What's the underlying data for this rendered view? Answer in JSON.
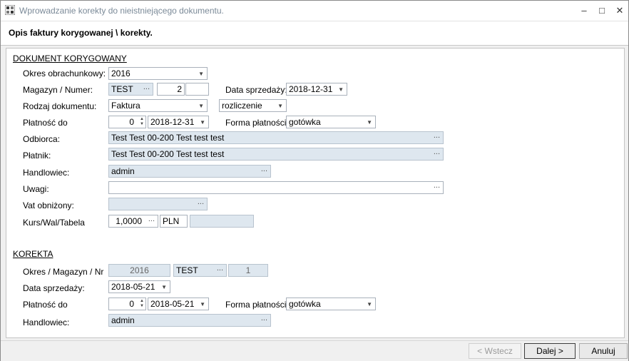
{
  "window": {
    "title": "Wprowadzanie korekty do nieistniejącego dokumentu.",
    "header": "Opis faktury korygowanej \\ korekty."
  },
  "dokument": {
    "section_label": "DOKUMENT KORYGOWANY",
    "okres": {
      "label": "Okres obrachunkowy:",
      "value": "2016"
    },
    "magazyn": {
      "label": "Magazyn / Numer:",
      "value": "TEST",
      "numer": "2",
      "suffix": ""
    },
    "data_sprzedazy": {
      "label": "Data sprzedaży:",
      "value": "2018-12-31"
    },
    "rodzaj": {
      "label": "Rodzaj dokumentu:",
      "value": "Faktura",
      "rozliczenie": "rozliczenie"
    },
    "platnosc": {
      "label": "Płatność do",
      "days": "0",
      "date": "2018-12-31"
    },
    "forma": {
      "label": "Forma płatności:",
      "value": "gotówka"
    },
    "odbiorca": {
      "label": "Odbiorca:",
      "value": "Test Test 00-200 Test test test"
    },
    "platnik": {
      "label": "Płatnik:",
      "value": "Test Test 00-200 Test test test"
    },
    "handlowiec": {
      "label": "Handlowiec:",
      "value": "admin"
    },
    "uwagi": {
      "label": "Uwagi:",
      "value": ""
    },
    "vat": {
      "label": "Vat obniżony:",
      "value": ""
    },
    "kurs": {
      "label": "Kurs/Wal/Tabela",
      "value": "1,0000",
      "waluta": "PLN",
      "tabela": ""
    }
  },
  "korekta": {
    "section_label": "KOREKTA",
    "okres": {
      "label": "Okres / Magazyn / Nr",
      "okres": "2016",
      "magazyn": "TEST",
      "nr": "1"
    },
    "data_sprzedazy": {
      "label": "Data sprzedaży:",
      "value": "2018-05-21"
    },
    "platnosc": {
      "label": "Płatność do",
      "days": "0",
      "date": "2018-05-21"
    },
    "forma": {
      "label": "Forma płatności:",
      "value": "gotówka"
    },
    "handlowiec": {
      "label": "Handlowiec:",
      "value": "admin"
    }
  },
  "buttons": {
    "back": "< Wstecz",
    "next": "Dalej >",
    "cancel": "Anuluj"
  },
  "icons": {
    "dropdown": "▼",
    "ellipsis": "...",
    "spin": "▲▼",
    "minimize": "–",
    "maximize": "□",
    "close": "✕"
  }
}
